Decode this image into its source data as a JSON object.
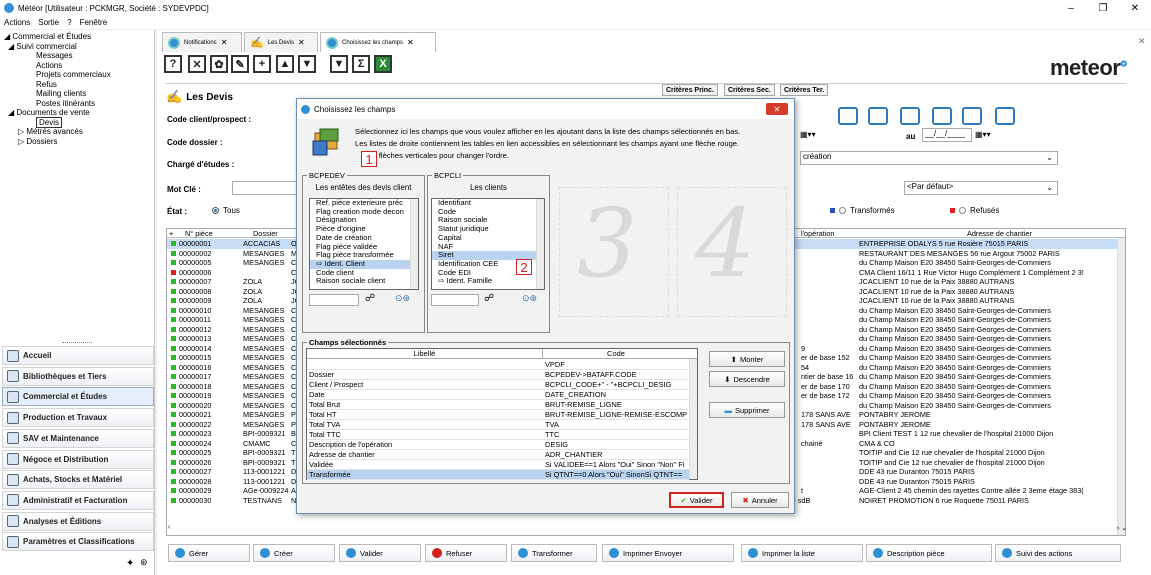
{
  "window": {
    "title": "Météor [Utilisateur : PCKMGR, Société : SYDEVPDC]",
    "minimize": "–",
    "maximize": "❐",
    "close": "✕"
  },
  "menu": [
    "Actions",
    "Sortie",
    "?",
    "Fenêtre"
  ],
  "tree": [
    {
      "label": "◢ Commercial et Études",
      "indent": 4
    },
    {
      "label": "◢ Suivi commercial",
      "indent": 8
    },
    {
      "label": "Messages",
      "indent": 36
    },
    {
      "label": "Actions",
      "indent": 36
    },
    {
      "label": "Projets commerciaux",
      "indent": 36
    },
    {
      "label": "Refus",
      "indent": 36
    },
    {
      "label": "Mailing clients",
      "indent": 36
    },
    {
      "label": "Postes itinérants",
      "indent": 36
    },
    {
      "label": "◢ Documents de vente",
      "indent": 8
    },
    {
      "label": "Devis",
      "indent": 36,
      "boxed": true
    },
    {
      "label": "▷ Métrés avancés",
      "indent": 18
    },
    {
      "label": "▷ Dossiers",
      "indent": 18
    }
  ],
  "nav": [
    "Accueil",
    "Bibliothèques et Tiers",
    "Commercial et Études",
    "Production et Travaux",
    "SAV et Maintenance",
    "Négoce et Distribution",
    "Achats, Stocks et Matériel",
    "Administratif et Facturation",
    "Analyses et Éditions",
    "Paramètres et Classifications"
  ],
  "nav_active_index": 2,
  "tabs": [
    {
      "label": "Notifications",
      "active": false
    },
    {
      "label": "Les Devis",
      "active": false
    },
    {
      "label": "Choisissez les champs",
      "active": true
    }
  ],
  "toolbar_icons": [
    "help-icon",
    "close-icon",
    "settings-icon",
    "edit-icon",
    "add-icon",
    "move-up-icon",
    "move-down-icon",
    "filter-icon",
    "sum-icon",
    "excel-icon"
  ],
  "toolbar_glyphs": [
    "?",
    "✕",
    "✿",
    "✎",
    "+",
    "▲",
    "▼",
    "▼",
    "Σ",
    "X"
  ],
  "logo": "meteor",
  "panel": {
    "title": "Les Devis",
    "client_label": "Code client/prospect :",
    "dossier_label": "Code dossier :",
    "charge_label": "Chargé d'études :",
    "motcle_label": "Mot Clé :",
    "etat_label": "État :",
    "etat_tous": "Tous",
    "au_label": "au",
    "date_placeholder": "__/__/____",
    "creation_select": "création",
    "par_defaut": "<Par défaut>",
    "transformes": "Transformés",
    "refuses": "Refusés"
  },
  "criteria_tabs": [
    "Critères Princ.",
    "Critères Sec.",
    "Critères Ter."
  ],
  "grid": {
    "headers": [
      "N° pièce",
      "Dossier",
      "l'opération",
      "Adresse de chantier"
    ],
    "rows": [
      {
        "color": "#2db82d",
        "num": "00000001",
        "dossier": "ACCACIAS",
        "c": "O",
        "op": "",
        "adresse": "ENTREPRISE ODALYS 5 rue Rosière  75015 PARIS",
        "sel": true
      },
      {
        "color": "#2db82d",
        "num": "00000002",
        "dossier": "MESANGES",
        "c": "M",
        "op": "",
        "adresse": "RESTAURANT DES MESANGES 56 rue Argout  75002 PARIS"
      },
      {
        "color": "#2db82d",
        "num": "00000005",
        "dossier": "MESANGES",
        "c": "C",
        "op": "",
        "adresse": "du Champ Maison E20  38450 Saint-Georges-de-Commiers"
      },
      {
        "color": "#e02020",
        "num": "00000006",
        "dossier": "",
        "c": "C",
        "op": "",
        "adresse": "CMA Client 16/11 1 Rue Victor Hugo Complément 1 Complément 2 3!"
      },
      {
        "color": "#2db82d",
        "num": "00000007",
        "dossier": "ZOLA",
        "c": "JC",
        "op": "",
        "adresse": "JCACLIENT 10 rue de la Paix  38880 AUTRANS"
      },
      {
        "color": "#2db82d",
        "num": "00000008",
        "dossier": "ZOLA",
        "c": "JC",
        "op": "",
        "adresse": "JCACLIENT 10 rue de la Paix  38880 AUTRANS"
      },
      {
        "color": "#2db82d",
        "num": "00000009",
        "dossier": "ZOLA",
        "c": "JC",
        "op": "",
        "adresse": "JCACLIENT 10 rue de la Paix  38880 AUTRANS"
      },
      {
        "color": "#2db82d",
        "num": "00000010",
        "dossier": "MESANGES",
        "c": "C",
        "op": "",
        "adresse": "du Champ Maison E20  38450 Saint-Georges-de-Commiers"
      },
      {
        "color": "#2db82d",
        "num": "00000011",
        "dossier": "MESANGES",
        "c": "C",
        "op": "",
        "adresse": "du Champ Maison E20  38450 Saint-Georges-de-Commiers"
      },
      {
        "color": "#2db82d",
        "num": "00000012",
        "dossier": "MESANGES",
        "c": "C",
        "op": "",
        "adresse": "du Champ Maison E20  38450 Saint-Georges-de-Commiers"
      },
      {
        "color": "#2db82d",
        "num": "00000013",
        "dossier": "MESANGES",
        "c": "C",
        "op": "",
        "adresse": "du Champ Maison E20  38450 Saint-Georges-de-Commiers"
      },
      {
        "color": "#2db82d",
        "num": "00000014",
        "dossier": "MESANGES",
        "c": "C",
        "op": "9",
        "adresse": "du Champ Maison E20  38450 Saint-Georges-de-Commiers"
      },
      {
        "color": "#2db82d",
        "num": "00000015",
        "dossier": "MESANGES",
        "c": "C",
        "op": "er de base 152",
        "adresse": "du Champ Maison E20  38450 Saint-Georges-de-Commiers"
      },
      {
        "color": "#2db82d",
        "num": "00000016",
        "dossier": "MESANGES",
        "c": "C",
        "op": "54",
        "adresse": "du Champ Maison E20  38450 Saint-Georges-de-Commiers"
      },
      {
        "color": "#2db82d",
        "num": "00000017",
        "dossier": "MESANGES",
        "c": "C",
        "op": "ntier de base 16",
        "adresse": "du Champ Maison E20  38450 Saint-Georges-de-Commiers"
      },
      {
        "color": "#2db82d",
        "num": "00000018",
        "dossier": "MESANGES",
        "c": "C",
        "op": "er de base 170",
        "adresse": "du Champ Maison E20  38450 Saint-Georges-de-Commiers"
      },
      {
        "color": "#2db82d",
        "num": "00000019",
        "dossier": "MESANGES",
        "c": "C",
        "op": "er de base 172",
        "adresse": "du Champ Maison E20  38450 Saint-Georges-de-Commiers"
      },
      {
        "color": "#2db82d",
        "num": "00000020",
        "dossier": "MESANGES",
        "c": "C",
        "op": "",
        "adresse": "du Champ Maison E20  38450 Saint-Georges-de-Commiers"
      },
      {
        "color": "#2db82d",
        "num": "00000021",
        "dossier": "MESANGES",
        "c": "P",
        "op": "178 SANS AVE",
        "adresse": "PONTABRY JEROME"
      },
      {
        "color": "#2db82d",
        "num": "00000022",
        "dossier": "MESANGES",
        "c": "P",
        "op": "178 SANS AVE",
        "adresse": "PONTABRY JEROME"
      },
      {
        "color": "#2db82d",
        "num": "00000023",
        "dossier": "BPI-0009321",
        "c": "B",
        "op": "",
        "adresse": "BPI Client TEST 1 12 rue chevalier de l'hospital  21000 Dijon"
      },
      {
        "color": "#2db82d",
        "num": "00000024",
        "dossier": "CMAMC",
        "c": "C",
        "op": "chainé",
        "adresse": "CMA & CO"
      },
      {
        "color": "#2db82d",
        "num": "00000025",
        "dossier": "BPI-0009321",
        "c": "T",
        "op": "",
        "adresse": "TOITIP and Cie 12 rue chevalier de l'hospital  21000 Dijon"
      },
      {
        "color": "#2db82d",
        "num": "00000026",
        "dossier": "BPI-0009321",
        "c": "T",
        "op": "",
        "adresse": "TOITIP and Cie 12 rue chevalier de l'hospital  21000 Dijon"
      },
      {
        "color": "#2db82d",
        "num": "00000027",
        "dossier": "113-0001221",
        "c": "D",
        "op": "",
        "adresse": "DDE 43 rue Duranton  75015 PARIS"
      },
      {
        "color": "#2db82d",
        "num": "00000028",
        "dossier": "113-0001221",
        "c": "D",
        "op": "",
        "adresse": "DDE 43 rue Duranton  75015 PARIS"
      },
      {
        "color": "#2db82d",
        "num": "00000029",
        "dossier": "AGe-0009224",
        "c": "A",
        "op": "t",
        "adresse": "AGE-Client 2 45 chemin des rayettes Contre allée 2 3eme étage 383("
      },
      {
        "color": "#2db82d",
        "num": "00000030",
        "dossier": "TESTNANS",
        "c": "NOIRET - NOIRET PROMOTION",
        "date": "19/05/2022",
        "v1": "8 508,17",
        "v2": "8 508,17",
        "v3": "1 701,63",
        "v4": "10 209,80",
        "op": "rénovation d'une sdB",
        "adresse": "NOIRET PROMOTION 6 rue Roquette  75011 PARIS"
      }
    ]
  },
  "bottom_buttons": [
    "Gérer",
    "Créer",
    "Valider",
    "Refuser",
    "Transformer",
    "Imprimer Envoyer",
    "Imprimer la liste",
    "Description pièce",
    "Suivi des actions"
  ],
  "dialog": {
    "title": "Choisissez les champs",
    "close": "✕",
    "instruction_1": "Sélectionnez ici les champs que vous voulez afficher en les ajoutant dans la liste des champs sélectionnés en bas.",
    "instruction_2": "Les listes de droite contiennent les tables en lien accessibles en sélectionnant les champs ayant une flèche rouge.",
    "instruction_3": "les flèches verticales pour changer l'ordre.",
    "badge1": "1",
    "badge2": "2",
    "box1_title": "BCPEDEV",
    "box1_header": "Les entêtes des devis client",
    "box1_items": [
      "Ref. pièce exterieure préc",
      "Flag creation mode decon",
      "Désignation",
      "Pièce d'origine",
      "Date de création",
      "Flag pièce validée",
      "Flag pièce transformée",
      "⇨ Ident. Client",
      "Code client",
      "Raison sociale client"
    ],
    "box1_sel": 7,
    "box2_title": "BCPCLI",
    "box2_header": "Les clients",
    "box2_items": [
      "Identifiant",
      "Code",
      "Raison sociale",
      "Statut juridique",
      "Capital",
      "NAF",
      "Siret",
      "Identification CEE",
      "Code EDI",
      "⇨ Ident. Famille"
    ],
    "box2_sel": 6,
    "selected_title": "Champs sélectionnés",
    "col_libelle": "Libellé",
    "col_code": "Code",
    "selected_rows": [
      {
        "l": "",
        "c": "VPDF"
      },
      {
        "l": "Dossier",
        "c": "BCPEDEV->BATAFF.CODE"
      },
      {
        "l": "Client / Prospect",
        "c": "BCPCLI_CODE+\" - \"+BCPCLI_DESIG"
      },
      {
        "l": "Date",
        "c": "DATE_CREATION"
      },
      {
        "l": "Total Brut",
        "c": "BRUT-REMISE_LIGNE"
      },
      {
        "l": "Total HT",
        "c": "BRUT-REMISE_LIGNE-REMISE-ESCOMPTE"
      },
      {
        "l": "Total TVA",
        "c": "TVA"
      },
      {
        "l": "Total TTC",
        "c": "TTC"
      },
      {
        "l": "Description de l'opération",
        "c": "DESIG"
      },
      {
        "l": "Adresse de chantier",
        "c": "ADR_CHANTIER"
      },
      {
        "l": "Validée",
        "c": "Si VALIDEE==1 Alors \"Oui\" Sinon \"Non\" Fi"
      },
      {
        "l": "Transformée",
        "c": "Si QTNT==0 Alors \"Oui\" SinonSi QTNT== "
      }
    ],
    "selected_sel": 11,
    "btn_monter": "Monter",
    "btn_descendre": "Descendre",
    "btn_supprimer": "Supprimer",
    "btn_valider": "Valider",
    "btn_annuler": "Annuler"
  },
  "colors": {
    "accent": "#2f8fd3",
    "green": "#2db82d",
    "red": "#e02020",
    "selection": "#c7dcf5"
  }
}
